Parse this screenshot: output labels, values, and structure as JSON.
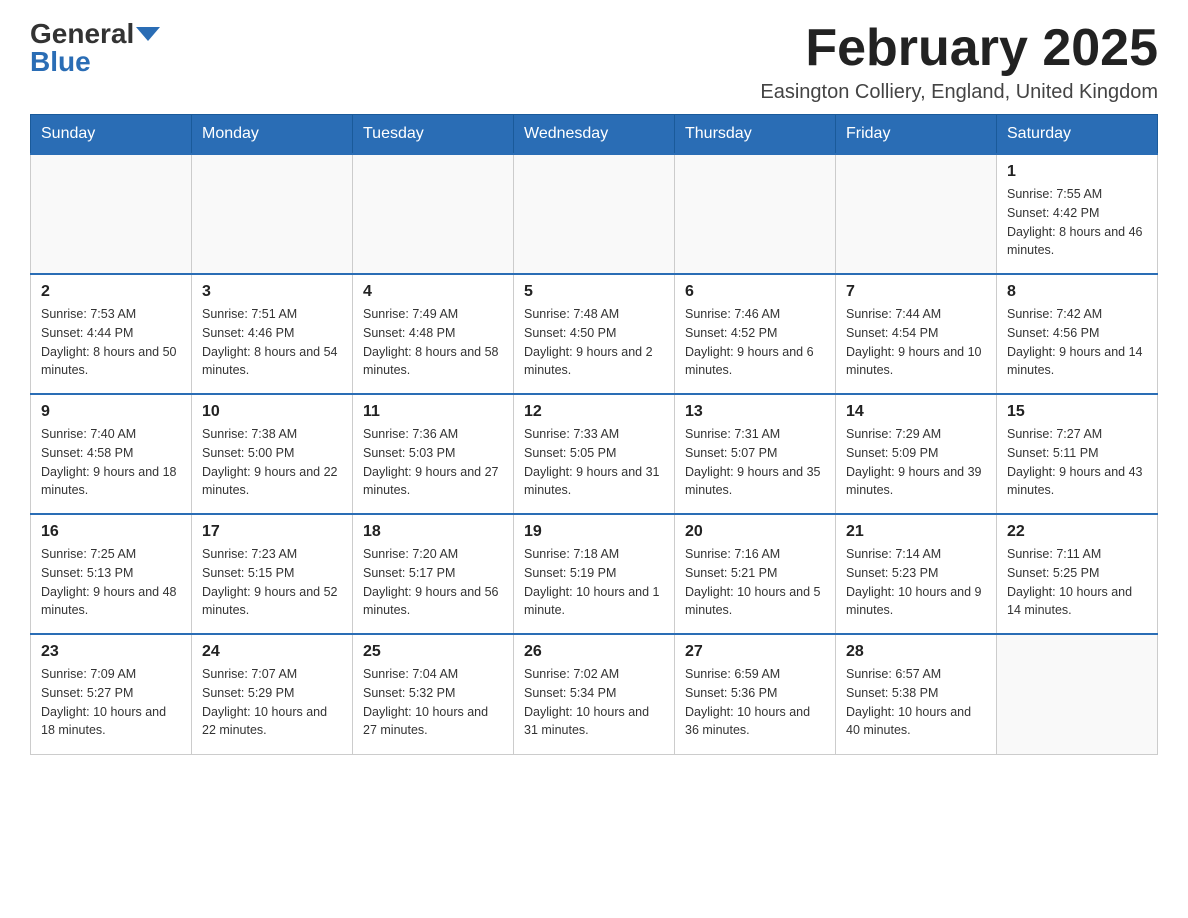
{
  "header": {
    "logo_general": "General",
    "logo_blue": "Blue",
    "month_title": "February 2025",
    "location": "Easington Colliery, England, United Kingdom"
  },
  "days_of_week": [
    "Sunday",
    "Monday",
    "Tuesday",
    "Wednesday",
    "Thursday",
    "Friday",
    "Saturday"
  ],
  "weeks": [
    [
      {
        "day": "",
        "info": ""
      },
      {
        "day": "",
        "info": ""
      },
      {
        "day": "",
        "info": ""
      },
      {
        "day": "",
        "info": ""
      },
      {
        "day": "",
        "info": ""
      },
      {
        "day": "",
        "info": ""
      },
      {
        "day": "1",
        "info": "Sunrise: 7:55 AM\nSunset: 4:42 PM\nDaylight: 8 hours and 46 minutes."
      }
    ],
    [
      {
        "day": "2",
        "info": "Sunrise: 7:53 AM\nSunset: 4:44 PM\nDaylight: 8 hours and 50 minutes."
      },
      {
        "day": "3",
        "info": "Sunrise: 7:51 AM\nSunset: 4:46 PM\nDaylight: 8 hours and 54 minutes."
      },
      {
        "day": "4",
        "info": "Sunrise: 7:49 AM\nSunset: 4:48 PM\nDaylight: 8 hours and 58 minutes."
      },
      {
        "day": "5",
        "info": "Sunrise: 7:48 AM\nSunset: 4:50 PM\nDaylight: 9 hours and 2 minutes."
      },
      {
        "day": "6",
        "info": "Sunrise: 7:46 AM\nSunset: 4:52 PM\nDaylight: 9 hours and 6 minutes."
      },
      {
        "day": "7",
        "info": "Sunrise: 7:44 AM\nSunset: 4:54 PM\nDaylight: 9 hours and 10 minutes."
      },
      {
        "day": "8",
        "info": "Sunrise: 7:42 AM\nSunset: 4:56 PM\nDaylight: 9 hours and 14 minutes."
      }
    ],
    [
      {
        "day": "9",
        "info": "Sunrise: 7:40 AM\nSunset: 4:58 PM\nDaylight: 9 hours and 18 minutes."
      },
      {
        "day": "10",
        "info": "Sunrise: 7:38 AM\nSunset: 5:00 PM\nDaylight: 9 hours and 22 minutes."
      },
      {
        "day": "11",
        "info": "Sunrise: 7:36 AM\nSunset: 5:03 PM\nDaylight: 9 hours and 27 minutes."
      },
      {
        "day": "12",
        "info": "Sunrise: 7:33 AM\nSunset: 5:05 PM\nDaylight: 9 hours and 31 minutes."
      },
      {
        "day": "13",
        "info": "Sunrise: 7:31 AM\nSunset: 5:07 PM\nDaylight: 9 hours and 35 minutes."
      },
      {
        "day": "14",
        "info": "Sunrise: 7:29 AM\nSunset: 5:09 PM\nDaylight: 9 hours and 39 minutes."
      },
      {
        "day": "15",
        "info": "Sunrise: 7:27 AM\nSunset: 5:11 PM\nDaylight: 9 hours and 43 minutes."
      }
    ],
    [
      {
        "day": "16",
        "info": "Sunrise: 7:25 AM\nSunset: 5:13 PM\nDaylight: 9 hours and 48 minutes."
      },
      {
        "day": "17",
        "info": "Sunrise: 7:23 AM\nSunset: 5:15 PM\nDaylight: 9 hours and 52 minutes."
      },
      {
        "day": "18",
        "info": "Sunrise: 7:20 AM\nSunset: 5:17 PM\nDaylight: 9 hours and 56 minutes."
      },
      {
        "day": "19",
        "info": "Sunrise: 7:18 AM\nSunset: 5:19 PM\nDaylight: 10 hours and 1 minute."
      },
      {
        "day": "20",
        "info": "Sunrise: 7:16 AM\nSunset: 5:21 PM\nDaylight: 10 hours and 5 minutes."
      },
      {
        "day": "21",
        "info": "Sunrise: 7:14 AM\nSunset: 5:23 PM\nDaylight: 10 hours and 9 minutes."
      },
      {
        "day": "22",
        "info": "Sunrise: 7:11 AM\nSunset: 5:25 PM\nDaylight: 10 hours and 14 minutes."
      }
    ],
    [
      {
        "day": "23",
        "info": "Sunrise: 7:09 AM\nSunset: 5:27 PM\nDaylight: 10 hours and 18 minutes."
      },
      {
        "day": "24",
        "info": "Sunrise: 7:07 AM\nSunset: 5:29 PM\nDaylight: 10 hours and 22 minutes."
      },
      {
        "day": "25",
        "info": "Sunrise: 7:04 AM\nSunset: 5:32 PM\nDaylight: 10 hours and 27 minutes."
      },
      {
        "day": "26",
        "info": "Sunrise: 7:02 AM\nSunset: 5:34 PM\nDaylight: 10 hours and 31 minutes."
      },
      {
        "day": "27",
        "info": "Sunrise: 6:59 AM\nSunset: 5:36 PM\nDaylight: 10 hours and 36 minutes."
      },
      {
        "day": "28",
        "info": "Sunrise: 6:57 AM\nSunset: 5:38 PM\nDaylight: 10 hours and 40 minutes."
      },
      {
        "day": "",
        "info": ""
      }
    ]
  ]
}
